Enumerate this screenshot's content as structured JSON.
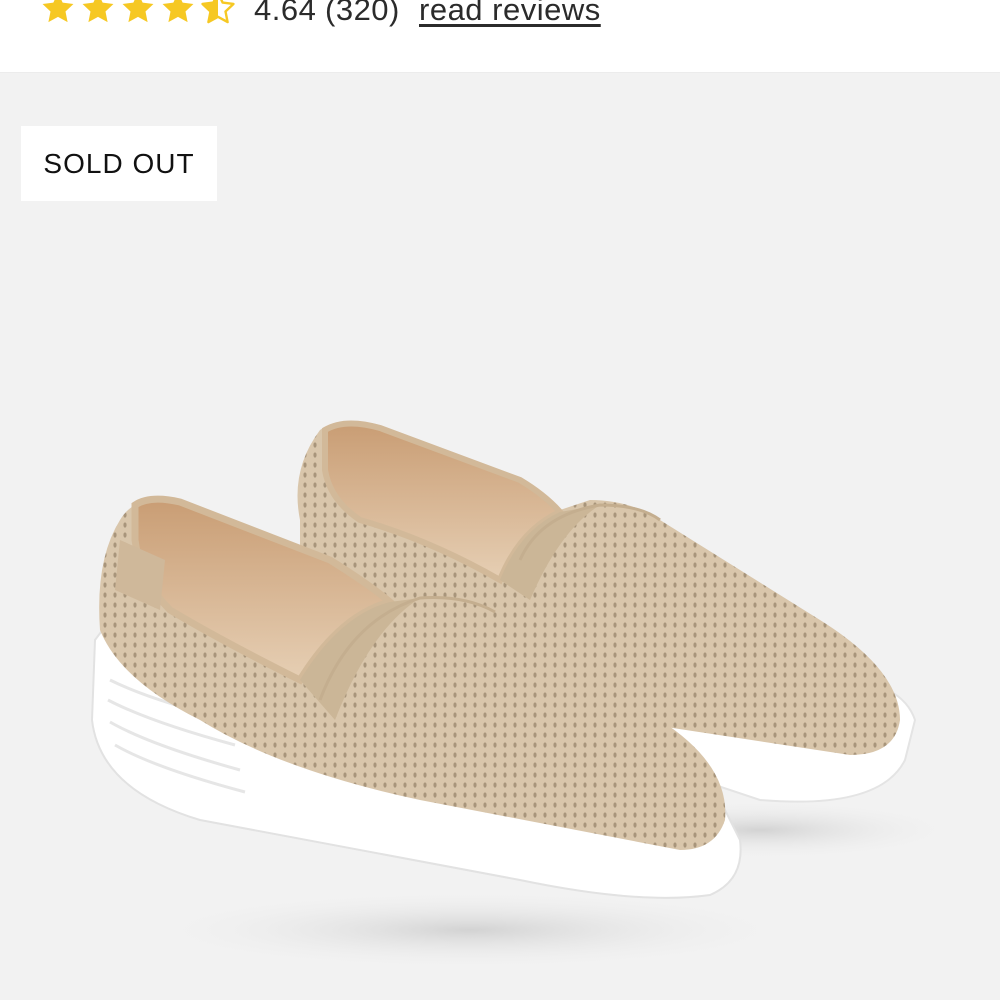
{
  "rating": {
    "stars": 4.5,
    "value": "4.64",
    "count": "(320)",
    "reviews_link": "read reviews",
    "star_color": "#f6c823"
  },
  "badge": {
    "label": "SOLD OUT"
  },
  "product": {
    "image_icon": "shoe-product-image",
    "mesh_color": "#d8c4a8",
    "sole_color": "#ffffff"
  }
}
